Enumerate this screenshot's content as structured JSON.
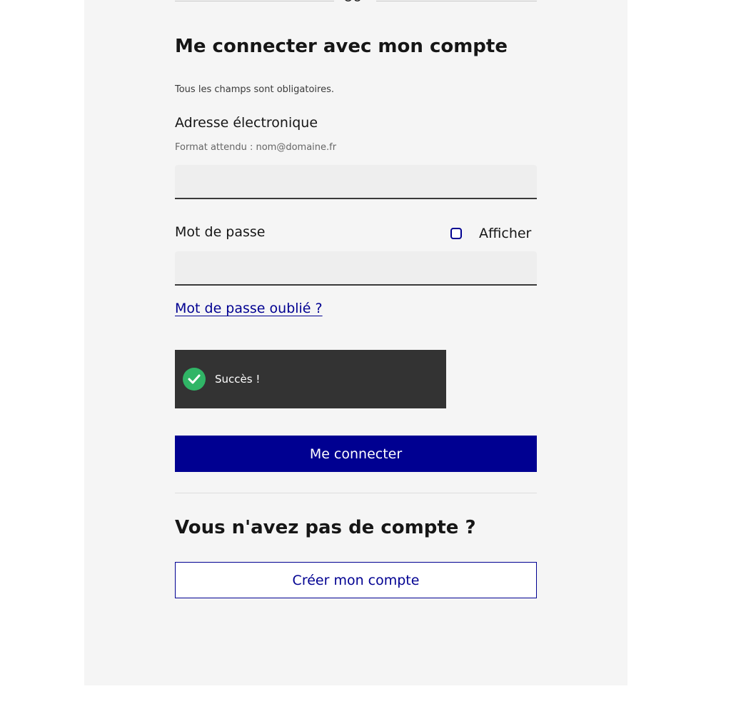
{
  "separator": {
    "label": "OU"
  },
  "login": {
    "title": "Me connecter avec mon compte",
    "required_note": "Tous les champs sont obligatoires.",
    "email": {
      "label": "Adresse électronique",
      "hint": "Format attendu : nom@domaine.fr",
      "value": "",
      "placeholder": ""
    },
    "password": {
      "label": "Mot de passe",
      "show_label": "Afficher",
      "show_checked": false,
      "value": "",
      "placeholder": ""
    },
    "forgot_link": "Mot de passe oublié ?",
    "captcha": {
      "status": "Succès !",
      "icon": "check-circle-icon"
    },
    "submit_label": "Me connecter"
  },
  "signup": {
    "title": "Vous n'avez pas de compte ?",
    "button_label": "Créer mon compte"
  },
  "colors": {
    "primary": "#000091",
    "panel": "#f5f5f5",
    "captcha_bg": "#333333",
    "success": "#30b566"
  }
}
